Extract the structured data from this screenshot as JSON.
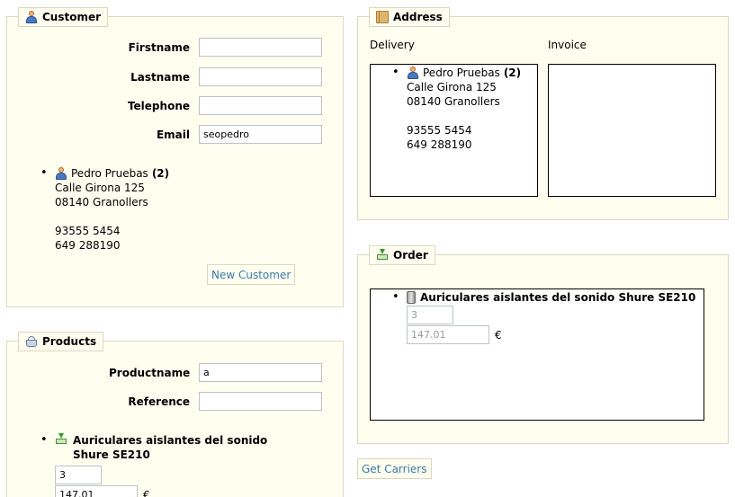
{
  "customer": {
    "legend": "Customer",
    "firstname_label": "Firstname",
    "lastname_label": "Lastname",
    "telephone_label": "Telephone",
    "email_label": "Email",
    "firstname_value": "",
    "lastname_value": "",
    "telephone_value": "",
    "email_value": "seopedro",
    "result": {
      "name": "Pedro Pruebas",
      "count": "(2)",
      "street": "Calle Girona 125",
      "city": "08140 Granollers",
      "phone1": "93555 5454",
      "phone2": "649 288190"
    },
    "new_customer_label": "New Customer"
  },
  "address": {
    "legend": "Address",
    "delivery_label": "Delivery",
    "invoice_label": "Invoice",
    "delivery": {
      "name": "Pedro Pruebas",
      "count": "(2)",
      "street": "Calle Girona 125",
      "city": "08140 Granollers",
      "phone1": "93555 5454",
      "phone2": "649 288190"
    }
  },
  "order": {
    "legend": "Order",
    "item_name": "Auriculares aislantes del sonido Shure SE210",
    "quantity": "3",
    "price": "147.01",
    "currency": "€"
  },
  "products": {
    "legend": "Products",
    "productname_label": "Productname",
    "reference_label": "Reference",
    "productname_value": "a",
    "reference_value": "",
    "result_name": "Auriculares aislantes del sonido Shure SE210",
    "quantity": "3",
    "price": "147.01",
    "currency": "€"
  },
  "get_carriers_label": "Get Carriers"
}
